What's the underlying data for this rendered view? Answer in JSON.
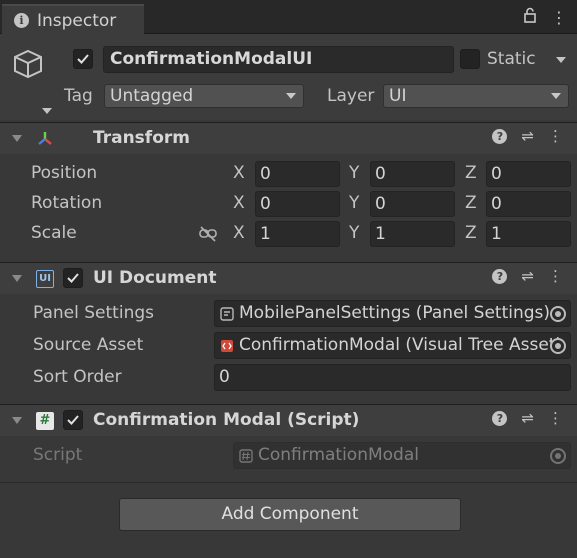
{
  "tab": {
    "title": "Inspector",
    "icon": "info-icon"
  },
  "toolbar": {
    "icons": [
      "lock-icon",
      "more-vertical-icon"
    ]
  },
  "gameobject": {
    "active": true,
    "name": "ConfirmationModalUI",
    "static_label": "Static",
    "static_checked": false,
    "tag_label": "Tag",
    "tag_value": "Untagged",
    "layer_label": "Layer",
    "layer_value": "UI"
  },
  "transform": {
    "title": "Transform",
    "rows": [
      {
        "label": "Position",
        "x": "0",
        "y": "0",
        "z": "0"
      },
      {
        "label": "Rotation",
        "x": "0",
        "y": "0",
        "z": "0"
      },
      {
        "label": "Scale",
        "x": "1",
        "y": "1",
        "z": "1"
      }
    ],
    "axes": {
      "x": "X",
      "y": "Y",
      "z": "Z"
    }
  },
  "ui_document": {
    "title": "UI Document",
    "icon_text": "UI",
    "enabled": true,
    "panel_settings_label": "Panel Settings",
    "panel_settings_value": "MobilePanelSettings (Panel Settings)",
    "source_asset_label": "Source Asset",
    "source_asset_value": "ConfirmationModal (Visual Tree Asset)",
    "sort_order_label": "Sort Order",
    "sort_order_value": "0"
  },
  "script_component": {
    "title": "Confirmation Modal (Script)",
    "icon_text": "#",
    "enabled": true,
    "script_label": "Script",
    "script_value": "ConfirmationModal"
  },
  "add_component_label": "Add Component",
  "colors": {
    "background": "#383838",
    "header": "#3e3e3e",
    "field": "#2a2a2a",
    "text": "#c4c4c4"
  }
}
